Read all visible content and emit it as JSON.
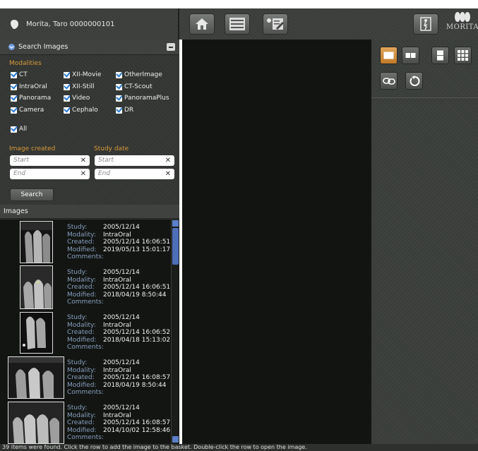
{
  "patient": {
    "name_id": "Morita, Taro  0000000101"
  },
  "toolbar": {
    "icons": [
      "home-icon",
      "image-list-icon",
      "report-edit-icon",
      "exit-icon"
    ],
    "logo_text": "MORITA"
  },
  "search_panel": {
    "title": "Search Images",
    "modalities_label": "Modalities",
    "modalities": [
      [
        "CT",
        "XII-Movie",
        "OtherImage"
      ],
      [
        "IntraOral",
        "XII-Still",
        "CT-Scout"
      ],
      [
        "Panorama",
        "Video",
        "PanoramaPlus"
      ],
      [
        "Camera",
        "Cephalo",
        "DR"
      ]
    ],
    "all_label": "All",
    "image_created_label": "Image created",
    "study_date_label": "Study date",
    "start_placeholder": "Start",
    "end_placeholder": "End",
    "search_button": "Search"
  },
  "images_panel": {
    "title": "Images",
    "field_labels": {
      "study": "Study:",
      "modality": "Modality:",
      "created": "Created:",
      "modified": "Modified:",
      "comments": "Comments:"
    },
    "rows": [
      {
        "study": "2005/12/14",
        "modality": "IntraOral",
        "created": "2005/12/14 16:06:51",
        "modified": "2019/05/13 15:01:17",
        "comments": ""
      },
      {
        "study": "2005/12/14",
        "modality": "IntraOral",
        "created": "2005/12/14 16:06:51",
        "modified": "2018/04/19 8:50:44",
        "comments": ""
      },
      {
        "study": "2005/12/14",
        "modality": "IntraOral",
        "created": "2005/12/14 16:06:52",
        "modified": "2018/04/18 15:13:02",
        "comments": ""
      },
      {
        "study": "2005/12/14",
        "modality": "IntraOral",
        "created": "2005/12/14 16:08:57",
        "modified": "2018/04/19 8:50:44",
        "comments": ""
      },
      {
        "study": "2005/12/14",
        "modality": "IntraOral",
        "created": "2005/12/14 16:08:57",
        "modified": "2014/10/02 12:58:46",
        "comments": ""
      }
    ]
  },
  "layout_tools": {
    "active": "single-view",
    "icons": [
      "single-view-icon",
      "two-view-icon",
      "vertical-split-icon",
      "grid-view-icon",
      "link-icon",
      "rotate-icon"
    ]
  },
  "status_bar": {
    "text": "39 items were found. Click the row to add the image to the basket. Double-click the row to open the image."
  },
  "colors": {
    "accent_orange": "#d89a3a",
    "panel_bg": "#333633",
    "label_blue": "#8aa0bf",
    "checkbox_blue": "#2a7bd6"
  }
}
